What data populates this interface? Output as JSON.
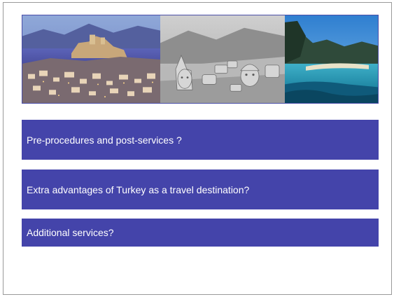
{
  "slide": {
    "images": [
      {
        "icon": "harbor-castle-photo"
      },
      {
        "icon": "ancient-stone-heads-photo"
      },
      {
        "icon": "lagoon-beach-photo"
      }
    ],
    "questions": [
      "Pre-procedures and post-services ?",
      "Extra advantages of Turkey as a travel destination?",
      "Additional services?"
    ],
    "colors": {
      "bar_fill": "#4444aa",
      "bar_text": "#ffffff",
      "photo_border": "#4a4ea8"
    }
  }
}
